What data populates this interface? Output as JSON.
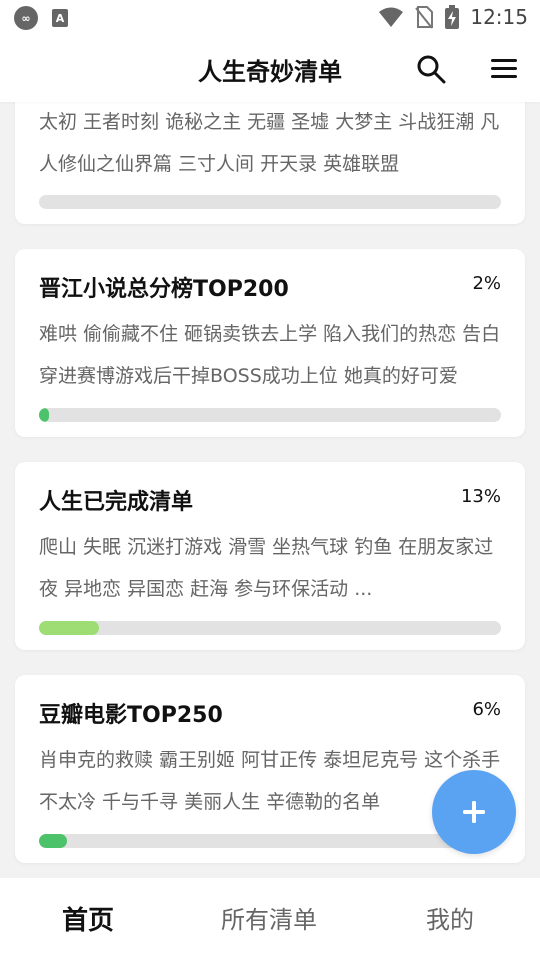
{
  "status_bar": {
    "time": "12:15",
    "left_icons": [
      "infinity-app-icon",
      "a-app-icon"
    ],
    "app_icon_text": "A"
  },
  "header": {
    "title": "人生奇妙清单",
    "actions": [
      "search-icon",
      "menu-icon"
    ]
  },
  "cards": [
    {
      "title": "",
      "percent": "",
      "progress": 0,
      "items": "太初  王者时刻  诡秘之主  无疆  圣墟  大梦主  斗战狂潮  凡人修仙之仙界篇  三寸人间  开天录  英雄联盟",
      "fill_color": "#4caf50"
    },
    {
      "title": "晋江小说总分榜TOP200",
      "percent": "2%",
      "progress": 0.02,
      "items": "难哄  偷偷藏不住  砸锅卖铁去上学  陷入我们的热恋  告白  穿进赛博游戏后干掉BOSS成功上位  她真的好可爱",
      "fill_color": "#4cc26a"
    },
    {
      "title": "人生已完成清单",
      "percent": "13%",
      "progress": 0.13,
      "items": "爬山  失眠  沉迷打游戏  滑雪  坐热气球  钓鱼  在朋友家过夜  异地恋  异国恋  赶海  参与环保活动  ...",
      "fill_color": "#9edc74"
    },
    {
      "title": "豆瓣电影TOP250",
      "percent": "6%",
      "progress": 0.06,
      "items": "肖申克的救赎  霸王别姬  阿甘正传  泰坦尼克号  这个杀手不太冷  千与千寻  美丽人生  辛德勒的名单",
      "fill_color": "#4cc26a"
    }
  ],
  "fab": {
    "icon": "plus-icon"
  },
  "bottom_nav": [
    {
      "label": "首页",
      "active": true
    },
    {
      "label": "所有清单",
      "active": false
    },
    {
      "label": "我的",
      "active": false
    }
  ],
  "colors": {
    "accent_fab": "#5aa2f2",
    "track": "#e2e2e2",
    "background": "#f2f2f2"
  }
}
